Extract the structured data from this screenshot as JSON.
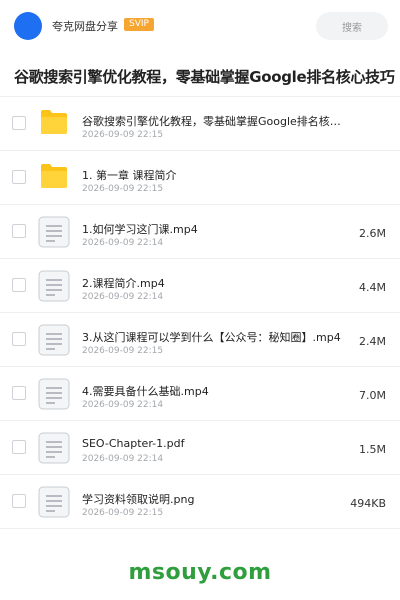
{
  "header": {
    "account_name": "夸克网盘分享",
    "badge": "SVIP",
    "search_placeholder": "搜索"
  },
  "folder_title": "谷歌搜索引擎优化教程，零基础掌握Google排名核心技巧",
  "files": [
    {
      "icon": "folder-icon",
      "name": "谷歌搜索引擎优化教程，零基础掌握Google排名核心技巧",
      "date": "2026-09-09 22:15",
      "size": ""
    },
    {
      "icon": "folder-icon",
      "name": "1. 第一章 课程简介",
      "date": "2026-09-09 22:15",
      "size": ""
    },
    {
      "icon": "document-icon",
      "name": "1.如何学习这门课.mp4",
      "date": "2026-09-09 22:14",
      "size": "2.6M"
    },
    {
      "icon": "document-icon",
      "name": "2.课程简介.mp4",
      "date": "2026-09-09 22:14",
      "size": "4.4M"
    },
    {
      "icon": "document-icon",
      "name": "3.从这门课程可以学到什么【公众号：秘知圈】.mp4",
      "date": "2026-09-09 22:15",
      "size": "2.4M"
    },
    {
      "icon": "document-icon",
      "name": "4.需要具备什么基础.mp4",
      "date": "2026-09-09 22:14",
      "size": "7.0M"
    },
    {
      "icon": "document-icon",
      "name": "SEO-Chapter-1.pdf",
      "date": "2026-09-09 22:14",
      "size": "1.5M"
    },
    {
      "icon": "document-icon",
      "name": "学习资料领取说明.png",
      "date": "2026-09-09 22:15",
      "size": "494KB"
    }
  ],
  "watermark": "msouy.com",
  "colors": {
    "avatar": "#1f6ff2",
    "badge": "#f7a531",
    "folder": "#fcc419",
    "watermark": "#2f9e3c"
  }
}
